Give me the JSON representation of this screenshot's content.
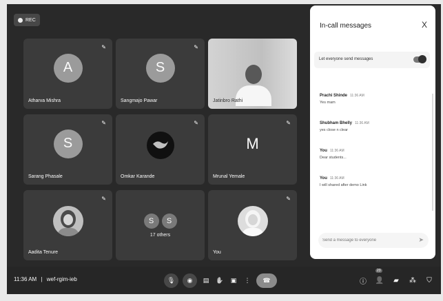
{
  "recording": {
    "label": "REC"
  },
  "tiles": {
    "t1": {
      "initial": "A",
      "name": "Atharva Mishra"
    },
    "t2": {
      "initial": "S",
      "name": "Sangmajo Pawar"
    },
    "t3": {
      "name": "Jatinbro Rathi"
    },
    "t4": {
      "initial": "S",
      "name": "Sarang Phasale"
    },
    "t5": {
      "name": "Omkar Karande"
    },
    "t6": {
      "initial": "M",
      "name": "Mrunal Yemale"
    },
    "t7": {
      "name": "Aadita Tenure"
    },
    "t8": {
      "initials": [
        "S",
        "S"
      ],
      "label": "17 others"
    },
    "t9": {
      "name": "You"
    }
  },
  "panel": {
    "title": "In-call messages",
    "close": "X",
    "toggle_label": "Let everyone send messages",
    "messages": [
      {
        "sender": "Prachi Shinde",
        "time": "11:36 AM",
        "text": "Yes mam"
      },
      {
        "sender": "Shubham Bhelly",
        "time": "11:36 AM",
        "text": "yes close n clear"
      },
      {
        "sender": "You",
        "time": "11:36 AM",
        "text": "Dear students..."
      },
      {
        "sender": "You",
        "time": "11:36 AM",
        "text": "I will shared after demo Link"
      }
    ],
    "input_placeholder": "Send a message to everyone"
  },
  "bottom": {
    "time": "11:36 AM",
    "separator": "|",
    "meeting_code": "wef-rgim-ieb",
    "participant_count": "23"
  },
  "icons": {
    "mic": "mic-icon",
    "cam": "camera-icon",
    "cc": "captions-icon",
    "hand": "raise-hand-icon",
    "present": "present-icon",
    "more": "more-options-icon",
    "end": "end-call-icon",
    "info": "info-icon",
    "people": "people-icon",
    "chat": "chat-icon",
    "activities": "activities-icon",
    "shield": "shield-icon"
  }
}
